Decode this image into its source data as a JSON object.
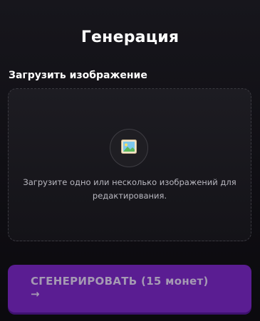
{
  "header": {
    "title": "Генерация"
  },
  "upload": {
    "label": "Загрузить изображение",
    "hint": "Загрузите одно или несколько изображений для редактирования.",
    "icon": "image-icon"
  },
  "generate": {
    "label": "СГЕНЕРИРОВАТЬ (15 монет)",
    "arrow": "→"
  },
  "colors": {
    "background": "#0f0e13",
    "button": "#5a1d92",
    "button_text": "#a59ab3",
    "hint_text": "#b9b8c0"
  }
}
